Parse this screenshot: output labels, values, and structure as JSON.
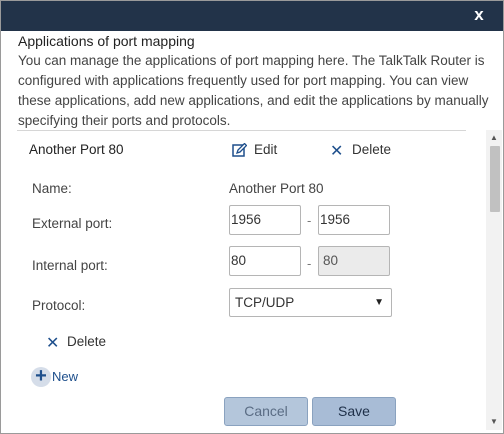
{
  "dialog": {
    "close_glyph": "x"
  },
  "intro": {
    "title": "Applications of port mapping",
    "description": "You can manage the applications of port mapping here. The TalkTalk Router is configured with applications frequently used for port mapping. You can view these applications, add new applications, and edit the applications by manually specifying their ports and protocols."
  },
  "app": {
    "name": "Another Port 80",
    "edit_label": "Edit",
    "delete_label": "Delete"
  },
  "form": {
    "name_label": "Name:",
    "name_value": "Another Port 80",
    "external_port_label": "External port:",
    "external_port_start": "1956",
    "external_port_end": "1956",
    "internal_port_label": "Internal port:",
    "internal_port_start": "80",
    "internal_port_end": "80",
    "range_separator": "-",
    "protocol_label": "Protocol:",
    "protocol_value": "TCP/UDP",
    "delete_label": "Delete",
    "new_label": "New"
  },
  "buttons": {
    "cancel_label": "Cancel",
    "save_label": "Save"
  },
  "icons": {
    "close": "close-icon",
    "edit": "pencil-icon",
    "delete": "x-icon",
    "new": "plus-icon",
    "select": "triangle-down-icon"
  },
  "colors": {
    "titlebar": "#223349",
    "accent": "#1e4f8c",
    "button_bg": "#a8bcd6"
  }
}
